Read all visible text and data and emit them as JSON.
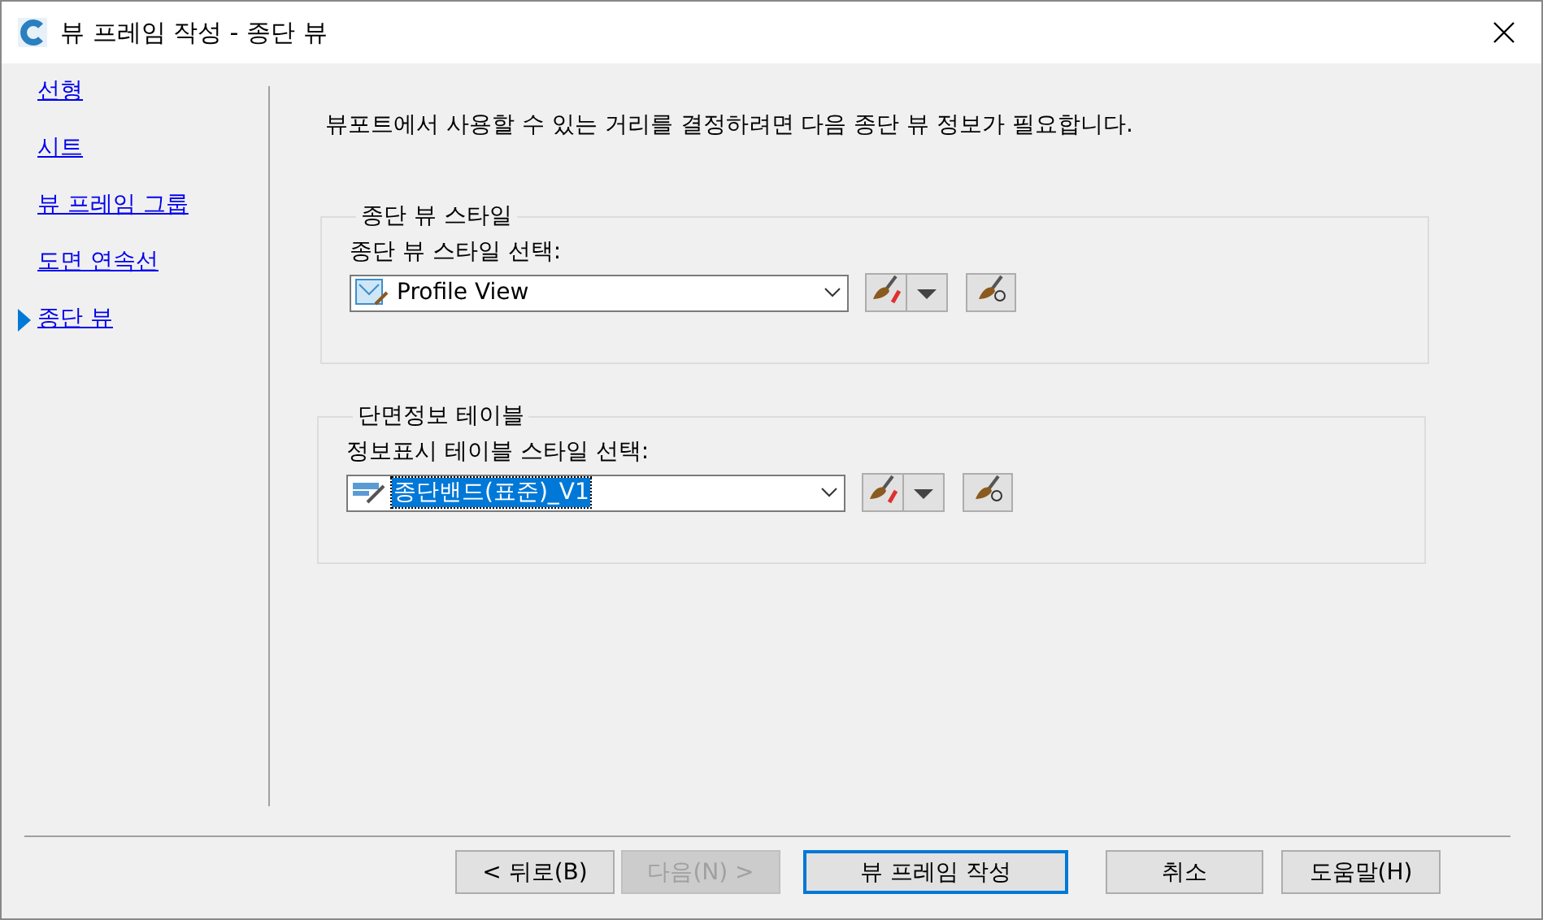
{
  "window": {
    "title": "뷰 프레임 작성 - 종단 뷰"
  },
  "nav": [
    {
      "label": "선형",
      "selected": false
    },
    {
      "label": "시트",
      "selected": false
    },
    {
      "label": "뷰 프레임 그룹",
      "selected": false
    },
    {
      "label": "도면 연속선",
      "selected": false
    },
    {
      "label": "종단 뷰",
      "selected": true
    }
  ],
  "description": "뷰포트에서 사용할 수 있는 거리를 결정하려면 다음 종단 뷰 정보가 필요합니다.",
  "groups": [
    {
      "legend": "종단 뷰 스타일",
      "label": "종단 뷰 스타일 선택:",
      "value": "Profile View",
      "value_selected": false
    },
    {
      "legend": "단면정보 테이블",
      "label": "정보표시 테이블 스타일 선택:",
      "value": "종단밴드(표준)_V1",
      "value_selected": true
    }
  ],
  "buttons": [
    {
      "label": "< 뒤로(B)",
      "disabled": false,
      "default": false
    },
    {
      "label": "다음(N) >",
      "disabled": true,
      "default": false
    },
    {
      "label": "뷰 프레임 작성",
      "disabled": false,
      "default": true
    },
    {
      "label": "취소",
      "disabled": false,
      "default": false
    },
    {
      "label": "도움말(H)",
      "disabled": false,
      "default": false
    }
  ]
}
